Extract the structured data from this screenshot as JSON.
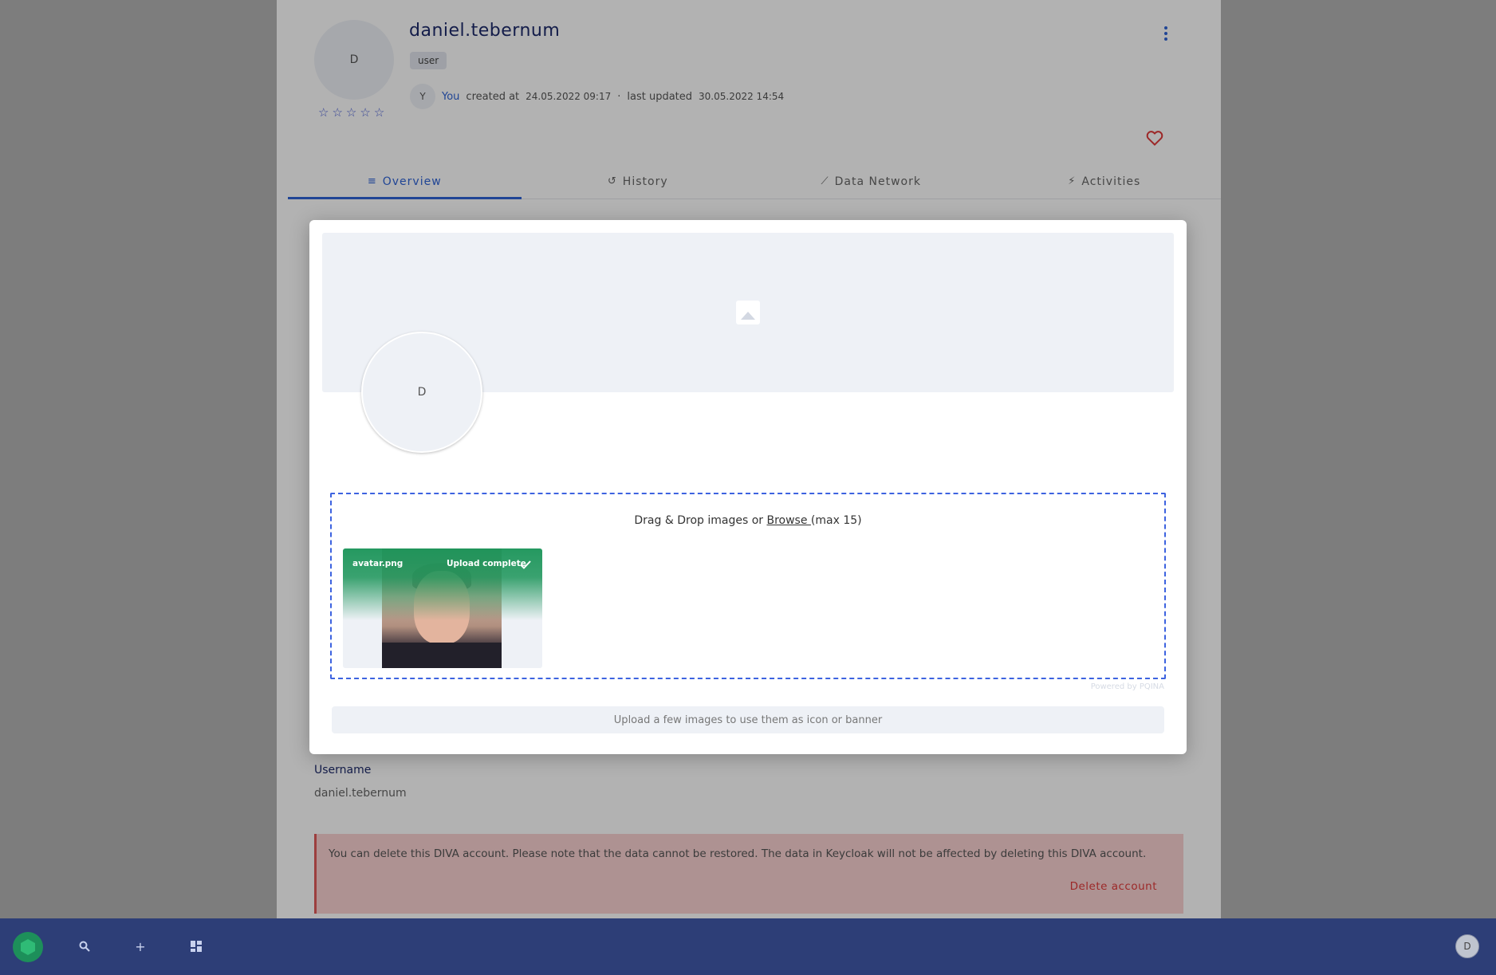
{
  "profile": {
    "avatar_initial": "D",
    "username": "daniel.tebernum",
    "role": "user",
    "rating_stars": 0,
    "meta": {
      "creator_initial": "Y",
      "creator": "You",
      "created_label": "created at",
      "created_at": "24.05.2022 09:17",
      "separator": "·",
      "updated_label": "last updated",
      "updated_at": "30.05.2022 14:54"
    }
  },
  "tabs": [
    {
      "label": "Overview",
      "icon": "list-icon",
      "active": true
    },
    {
      "label": "History",
      "icon": "history-icon",
      "active": false
    },
    {
      "label": "Data Network",
      "icon": "network-icon",
      "active": false
    },
    {
      "label": "Activities",
      "icon": "bolt-icon",
      "active": false
    }
  ],
  "fields": {
    "username_label": "Username",
    "username_value": "daniel.tebernum"
  },
  "delete_section": {
    "text": "You can delete this DIVA account. Please note that the data cannot be restored. The data in Keycloak will not be affected by deleting this DIVA account.",
    "button": "Delete account"
  },
  "modal": {
    "avatar_initial": "D",
    "dropzone": {
      "text_before": "Drag & Drop images or ",
      "browse": "Browse ",
      "text_after": "(max 15)"
    },
    "upload": {
      "filename": "avatar.png",
      "status": "Upload complete"
    },
    "powered_by": "Powered by PQINA",
    "hint": "Upload a few images to use them as icon or banner"
  },
  "bottom_bar": {
    "user_initial": "D",
    "icons": [
      "search-icon",
      "plus-icon",
      "dashboard-icon"
    ]
  },
  "colors": {
    "accent": "#2f63d6",
    "bottom_bar": "#2d3e77",
    "upload_success": "#1a9458",
    "danger": "#e03a3a"
  }
}
